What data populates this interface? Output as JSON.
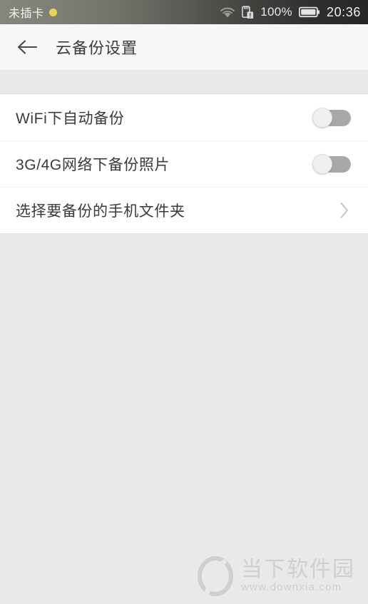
{
  "status_bar": {
    "sim_text": "未插卡",
    "sim_dot_color": "#e8d44d",
    "wifi_icon": "wifi-icon",
    "sd_card_icon": "sd-card-alert-icon",
    "battery_percent": "100%",
    "battery_icon": "battery-full-icon",
    "clock": "20:36",
    "background_from": "#85877c",
    "background_to": "#262724"
  },
  "app_bar": {
    "back_icon": "back-arrow-icon",
    "title": "云备份设置",
    "background": "#f7f7f7",
    "title_color": "#3c3c3c"
  },
  "settings": {
    "rows": [
      {
        "label": "WiFi下自动备份",
        "control": "toggle",
        "state": "off",
        "name": "wifi-auto-backup"
      },
      {
        "label": "3G/4G网络下备份照片",
        "control": "toggle",
        "state": "off",
        "name": "mobile-data-photo-backup"
      },
      {
        "label": "选择要备份的手机文件夹",
        "control": "chevron",
        "state": "",
        "name": "select-backup-folders"
      }
    ]
  },
  "watermark": {
    "logo": "downxia-o-logo",
    "site_name": "当下软件园",
    "url": "www.downxia.com",
    "color": "#cfcfcf"
  },
  "theme": {
    "page_background": "#e9e9e9",
    "list_background": "#ffffff",
    "divider": "#f2f2f2",
    "toggle_track_off": "#a8a8a8",
    "toggle_knob": "#efefef",
    "row_text": "#3a3a3a"
  }
}
